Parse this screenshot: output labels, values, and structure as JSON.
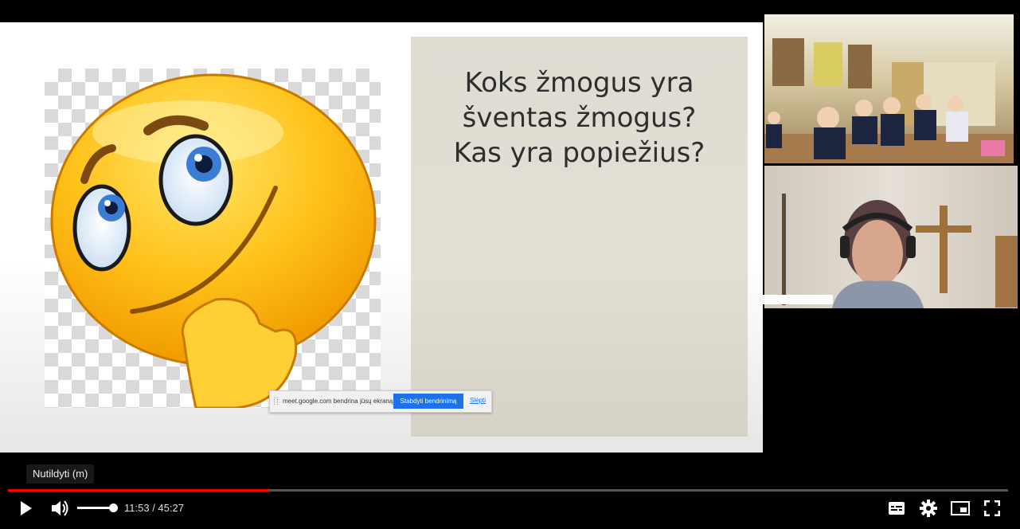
{
  "slide": {
    "title": "Koks žmogus yra\nšventas žmogus?\nKas yra popiežius?"
  },
  "share_bar": {
    "message": "meet.google.com bendrina jūsų ekraną.",
    "stop_button": "Stabdyti bendrinimą",
    "hide_link": "Slėpti"
  },
  "player": {
    "tooltip": "Nutildyti (m)",
    "current_time": "11:53",
    "duration": "45:27",
    "time_separator": " / ",
    "progress": 0.2614,
    "volume": 1.0,
    "colors": {
      "progress": "#ff0000",
      "background": "#000000"
    },
    "icons": [
      "play-icon",
      "volume-icon",
      "subtitles-icon",
      "settings-icon",
      "miniplayer-icon",
      "fullscreen-icon"
    ]
  }
}
